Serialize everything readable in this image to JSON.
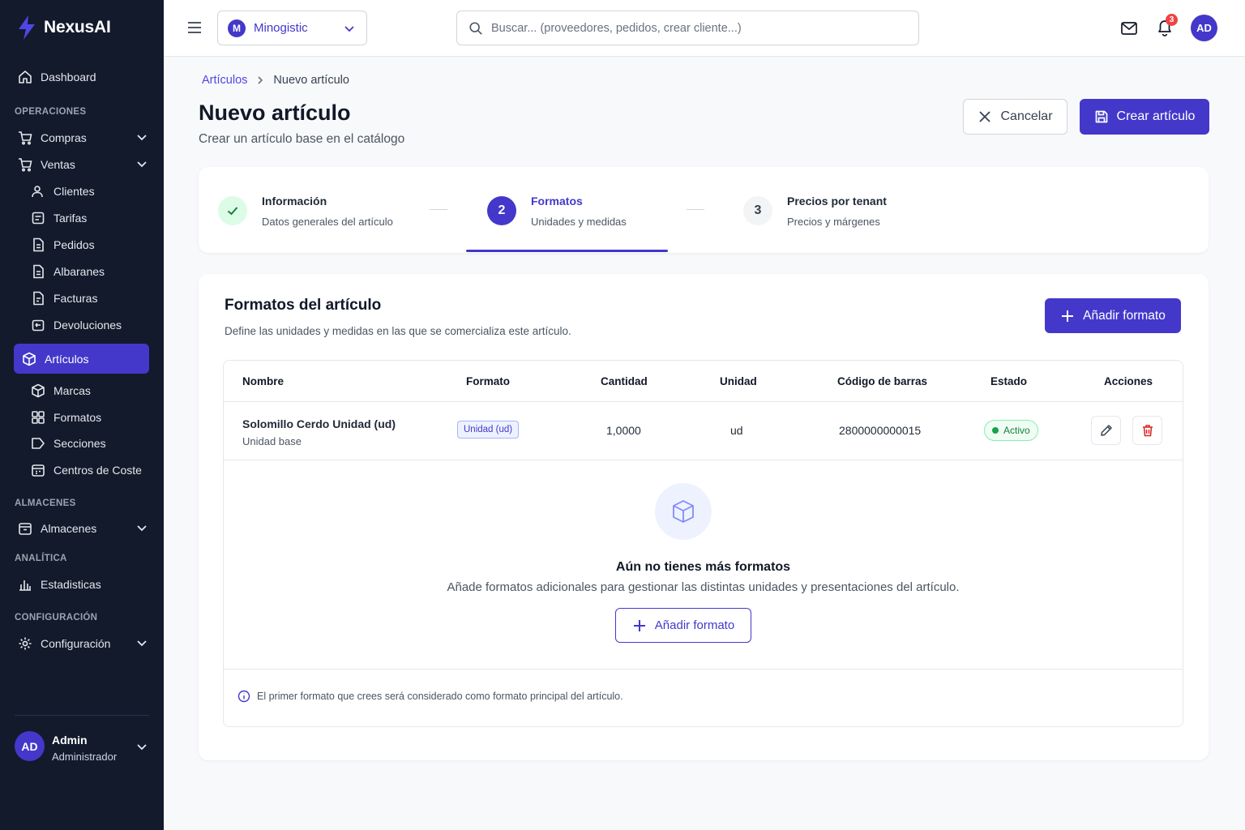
{
  "app": {
    "name": "NexusAI"
  },
  "sidebar": {
    "dashboard": "Dashboard",
    "sections": {
      "operaciones": "OPERACIONES",
      "almacenes": "ALMACENES",
      "analitica": "ANALÍTICA",
      "configuracion": "CONFIGURACIÓN"
    },
    "items": {
      "compras": "Compras",
      "ventas": "Ventas",
      "clientes": "Clientes",
      "tarifas": "Tarifas",
      "pedidos": "Pedidos",
      "albaranes": "Albaranes",
      "facturas": "Facturas",
      "devoluciones": "Devoluciones",
      "articulos": "Artículos",
      "marcas": "Marcas",
      "formatos": "Formatos",
      "secciones": "Secciones",
      "centros": "Centros de Coste",
      "almacenes": "Almacenes",
      "estadisticas": "Estadisticas",
      "configuracion": "Configuración"
    },
    "user": {
      "initials": "AD",
      "name": "Admin",
      "role": "Administrador"
    }
  },
  "topbar": {
    "tenant": {
      "initial": "M",
      "name": "Minogistic"
    },
    "search_placeholder": "Buscar... (proveedores, pedidos, crear cliente...)",
    "notifications_count": "3",
    "avatar_initials": "AD"
  },
  "header": {
    "breadcrumb": {
      "parent": "Artículos",
      "current": "Nuevo artículo"
    },
    "title": "Nuevo artículo",
    "subtitle": "Crear un artículo base en el catálogo",
    "cancel_label": "Cancelar",
    "create_label": "Crear artículo"
  },
  "stepper": {
    "steps": [
      {
        "number": "1",
        "title": "Información",
        "desc": "Datos generales del artículo",
        "state": "done"
      },
      {
        "number": "2",
        "title": "Formatos",
        "desc": "Unidades y medidas",
        "state": "active"
      },
      {
        "number": "3",
        "title": "Precios por tenant",
        "desc": "Precios y márgenes",
        "state": "pending"
      }
    ]
  },
  "formats": {
    "title": "Formatos del artículo",
    "description": "Define las unidades y medidas en las que se comercializa este artículo.",
    "add_label": "Añadir formato",
    "columns": [
      "Nombre",
      "Formato",
      "Cantidad",
      "Unidad",
      "Código de barras",
      "Estado",
      "Acciones"
    ],
    "rows": [
      {
        "name": "Solomillo Cerdo Unidad (ud)",
        "subtitle": "Unidad base",
        "format": "Unidad (ud)",
        "quantity": "1,0000",
        "unit": "ud",
        "barcode": "2800000000015",
        "status": "Activo"
      }
    ],
    "empty": {
      "title": "Aún no tienes más formatos",
      "desc": "Añade formatos adicionales para gestionar las distintas unidades y presentaciones del artículo.",
      "add_label": "Añadir formato"
    },
    "note": "El primer formato que crees será considerado como formato principal del artículo."
  },
  "colors": {
    "accent": "#4338ca",
    "sidebar_bg": "#121a2c",
    "success": "#16a34a",
    "danger": "#dc2626"
  }
}
